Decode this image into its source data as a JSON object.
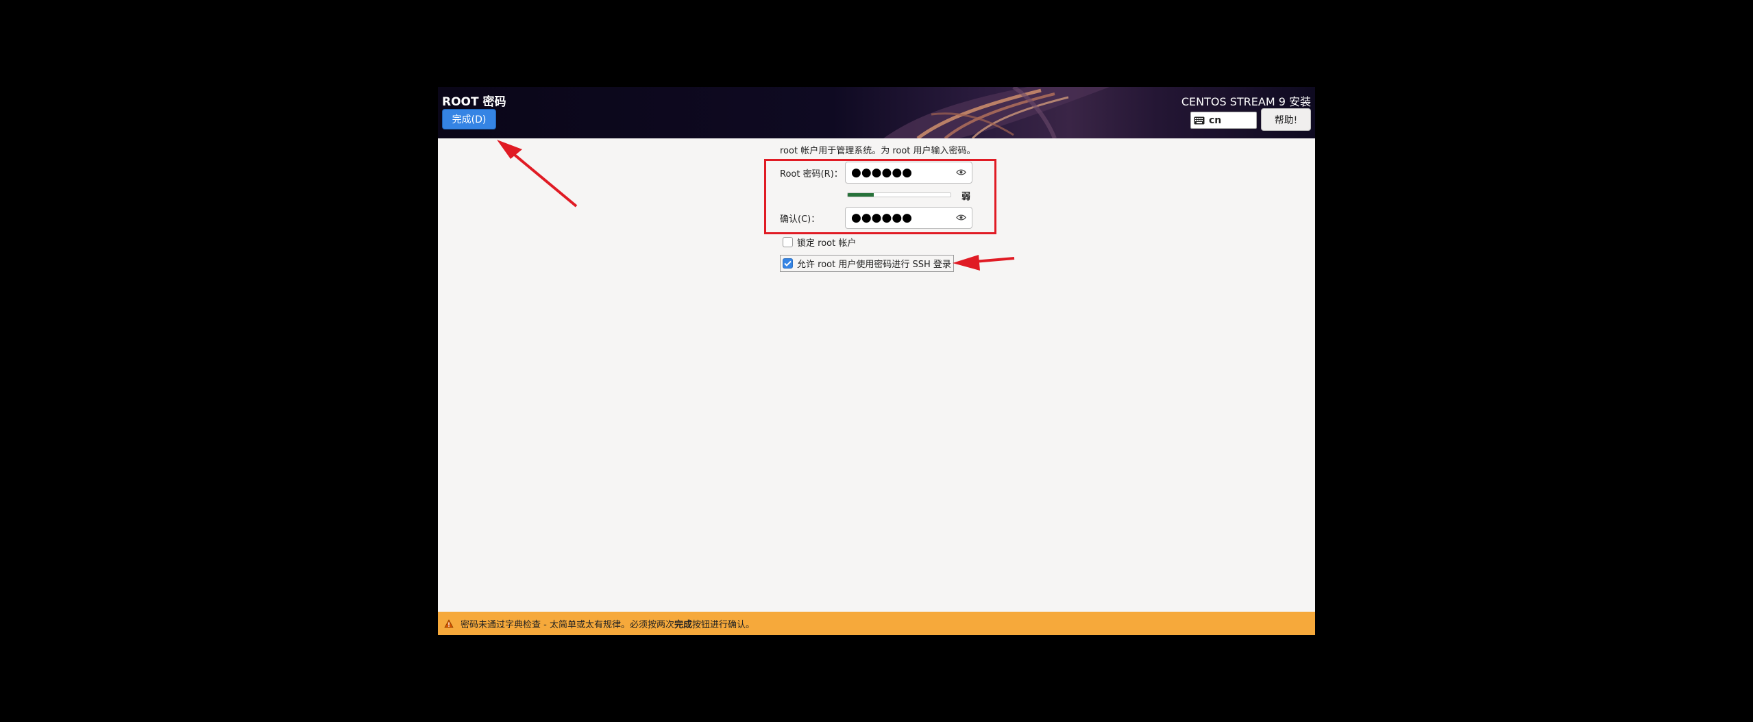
{
  "header": {
    "title": "ROOT 密码",
    "done_label": "完成(D)",
    "product": "CENTOS STREAM 9 安装",
    "keyboard_layout": "cn",
    "help_label": "帮助!"
  },
  "content": {
    "hint": "root 帐户用于管理系统。为 root 用户输入密码。",
    "password_label": "Root 密码(R)：",
    "password_value": "●●●●●●",
    "strength_label": "弱",
    "strength_level": 0.25,
    "confirm_label": "确认(C)：",
    "confirm_value": "●●●●●●",
    "lock_root_label": "锁定 root 帐户",
    "lock_root_checked": false,
    "allow_ssh_label": "允许 root 用户使用密码进行 SSH 登录",
    "allow_ssh_checked": true
  },
  "warning": {
    "text_before": "密码未通过字典检查 - 太简单或太有规律。必须按两次",
    "text_bold": "完成",
    "text_after": "按钮进行确认。"
  },
  "colors": {
    "accent": "#3584e4",
    "warning": "#f6a93b",
    "annotation": "#e01b24",
    "strength": "#27723a"
  }
}
